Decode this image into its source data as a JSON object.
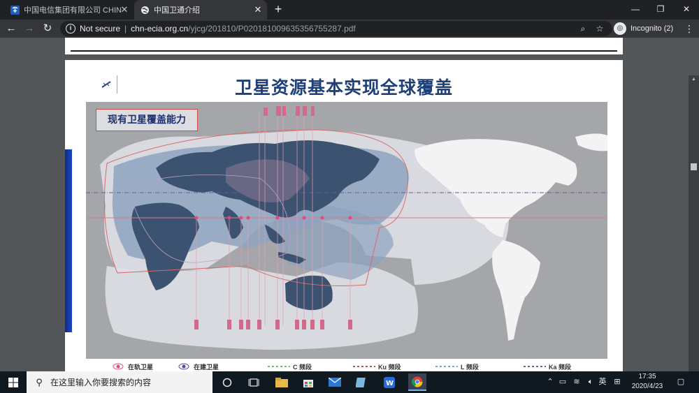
{
  "browser": {
    "tabs": [
      {
        "title": "中国电信集团有限公司 CHINA TELECOM",
        "active": false
      },
      {
        "title": "中国卫通介绍",
        "active": true
      }
    ],
    "new_tab_icon": "plus-icon",
    "window_controls": [
      "minimize",
      "restore",
      "close"
    ],
    "security_label": "Not secure",
    "url_domain": "chn-ecia.org.cn",
    "url_path": "/yjcg/201810/P020181009635356755287.pdf",
    "incognito_label": "Incognito (2)"
  },
  "slide": {
    "title": "卫星资源基本实现全球覆盖",
    "map_label": "现有卫星覆盖能力",
    "legend": [
      {
        "label": "在轨卫星",
        "color": "#e04a7a",
        "kind": "dot"
      },
      {
        "label": "在建卫星",
        "color": "#5a4a9a",
        "kind": "dot"
      },
      {
        "label": "C 频段",
        "color": "#6fbf6f",
        "kind": "dash"
      },
      {
        "label": "Ku 频段",
        "color": "#d84a4a",
        "kind": "dash"
      },
      {
        "label": "L 频段",
        "color": "#5ab0e0",
        "kind": "dash"
      },
      {
        "label": "Ka 频段",
        "color": "#7a5aa8",
        "kind": "dash"
      }
    ]
  },
  "taskbar": {
    "search_placeholder": "在这里输入你要搜索的内容",
    "ime_label": "英",
    "time": "17:35",
    "date": "2020/4/23"
  },
  "colors": {
    "title_blue": "#1f3f78",
    "chrome_dark": "#202124",
    "chrome_toolbar": "#35363a",
    "pdf_bg": "#525659"
  }
}
